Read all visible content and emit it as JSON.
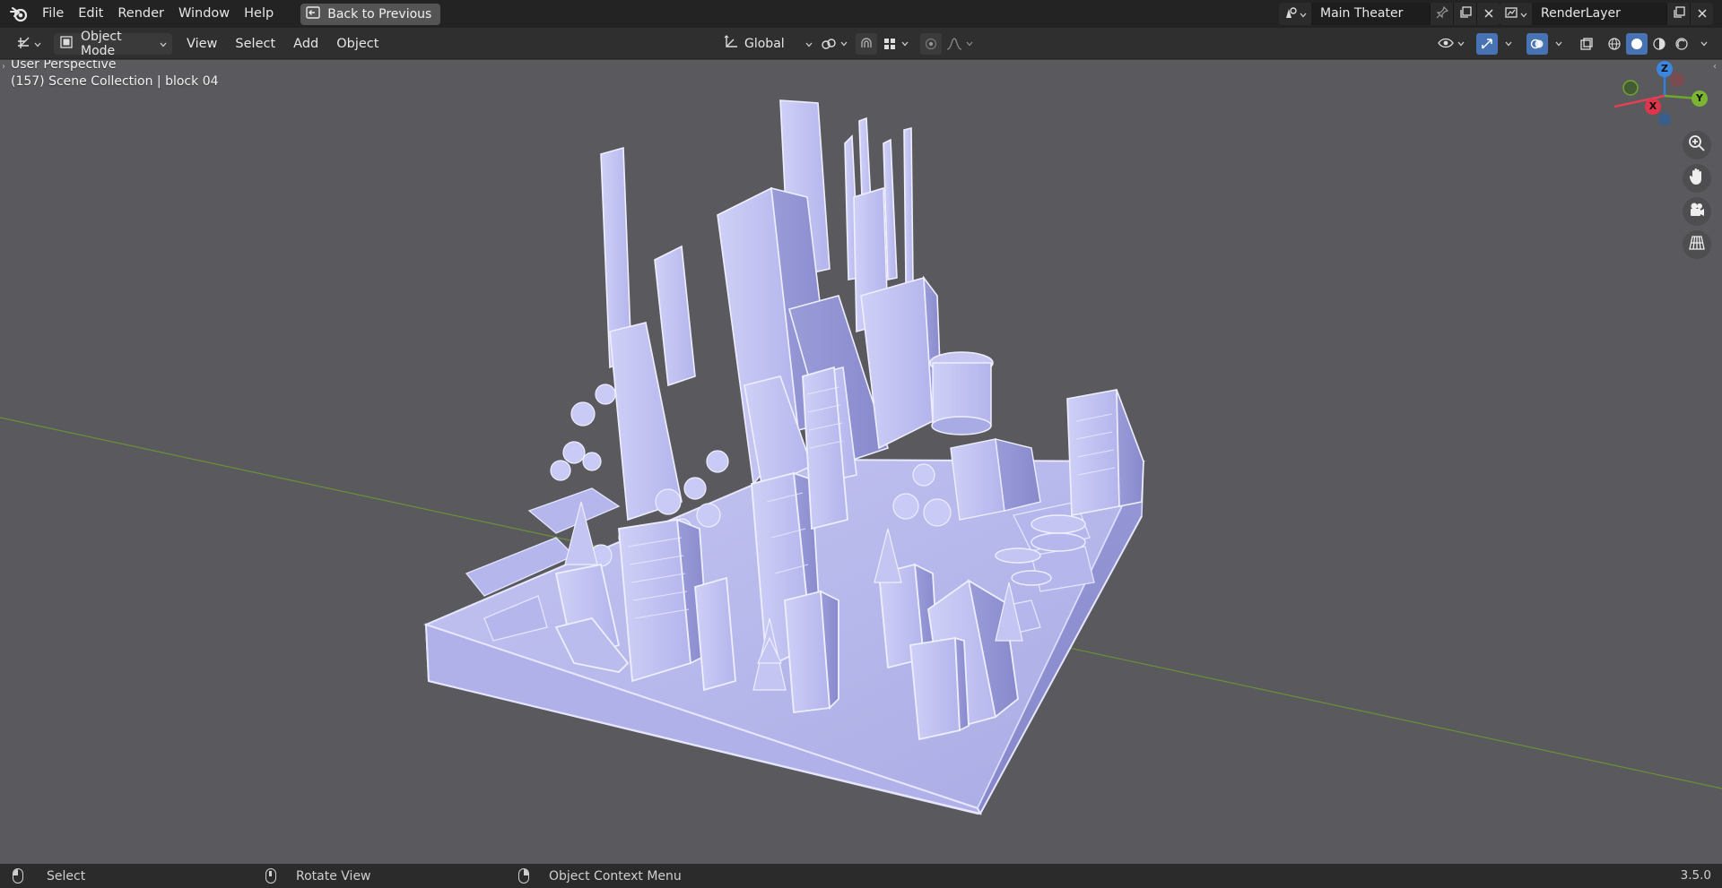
{
  "menubar": {
    "items": [
      "File",
      "Edit",
      "Render",
      "Window",
      "Help"
    ],
    "back_button": "Back to Previous"
  },
  "scene": {
    "name": "Main Theater"
  },
  "view_layer": {
    "name": "RenderLayer"
  },
  "header": {
    "mode": "Object Mode",
    "menus": [
      "View",
      "Select",
      "Add",
      "Object"
    ],
    "orientation": "Global"
  },
  "viewport": {
    "perspective_label": "User Perspective",
    "collection_label": "(157) Scene Collection | block 04",
    "gizmo_axes": {
      "z": "Z",
      "y": "Y",
      "x": "X"
    },
    "background_color": "#5a5a5e",
    "model_color": "#b7b8ee",
    "grid_axis_color": "#6a8f3a"
  },
  "statusbar": {
    "left": "Select",
    "middle": "Rotate View",
    "right": "Object Context Menu",
    "version": "3.5.0"
  },
  "icons": {
    "app": "blender-logo-icon",
    "back": "back-to-previous-icon",
    "navigation": [
      "zoom-icon",
      "pan-hand-icon",
      "camera-view-icon",
      "orthographic-grid-icon"
    ]
  }
}
